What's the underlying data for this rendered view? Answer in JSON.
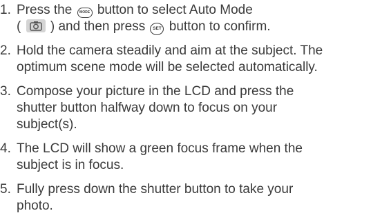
{
  "steps": [
    {
      "number": "1.",
      "line1_before_icon": "Press the ",
      "mode_icon_label": "MODE",
      "line1_after_icon": " button to select Auto Mode",
      "line2_open": "( ",
      "line2_after_cam": " ) and then press ",
      "set_icon_label": "SET",
      "line2_end": " button to confirm."
    },
    {
      "number": "2.",
      "lines": [
        "Hold the camera steadily and aim at the subject. The",
        "optimum scene mode will be selected automatically."
      ]
    },
    {
      "number": "3.",
      "lines": [
        "Compose your picture in the LCD and press the",
        "shutter button halfway down to focus on your",
        "subject(s)."
      ]
    },
    {
      "number": "4.",
      "lines": [
        "The LCD will show a green focus frame when the",
        "subject is in focus."
      ]
    },
    {
      "number": "5.",
      "lines": [
        "Fully press down the shutter button to take your",
        "photo."
      ]
    }
  ]
}
